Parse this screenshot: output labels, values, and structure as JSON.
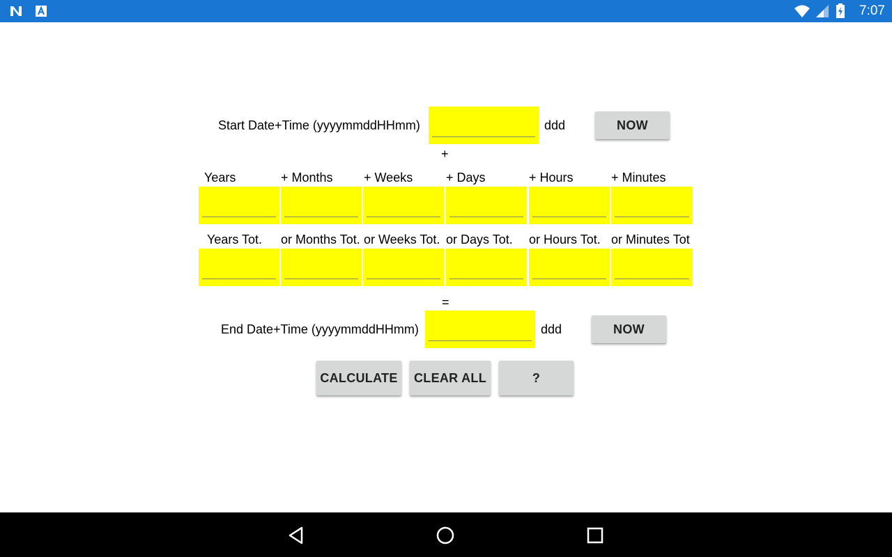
{
  "status_bar": {
    "time": "7:07",
    "icons": [
      "notification-n-icon",
      "accessibility-a-icon",
      "wifi-icon",
      "signal-icon",
      "battery-charging-icon"
    ]
  },
  "form": {
    "start_label": "Start Date+Time (yyyymmddHHmm)",
    "start_value": "",
    "start_day": "ddd",
    "start_now": "NOW",
    "plus_symbol": "+",
    "duration_headers": [
      "Years",
      "+ Months",
      "+ Weeks",
      "+ Days",
      "+ Hours",
      "+ Minutes"
    ],
    "duration_values": [
      "",
      "",
      "",
      "",
      "",
      ""
    ],
    "total_headers": [
      "Years Tot.",
      "or Months Tot.",
      "or Weeks Tot.",
      "or Days Tot.",
      "or Hours Tot.",
      "or Minutes Tot"
    ],
    "total_values": [
      "",
      "",
      "",
      "",
      "",
      ""
    ],
    "equals_symbol": "=",
    "end_label": "End Date+Time (yyyymmddHHmm)",
    "end_value": "",
    "end_day": "ddd",
    "end_now": "NOW"
  },
  "actions": {
    "calculate": "CALCULATE",
    "clear_all": "CLEAR ALL",
    "help": "?"
  },
  "colors": {
    "status_bar": "#1976d2",
    "field": "#ffff00",
    "button": "#d6d7d7",
    "nav_bar": "#000000"
  }
}
